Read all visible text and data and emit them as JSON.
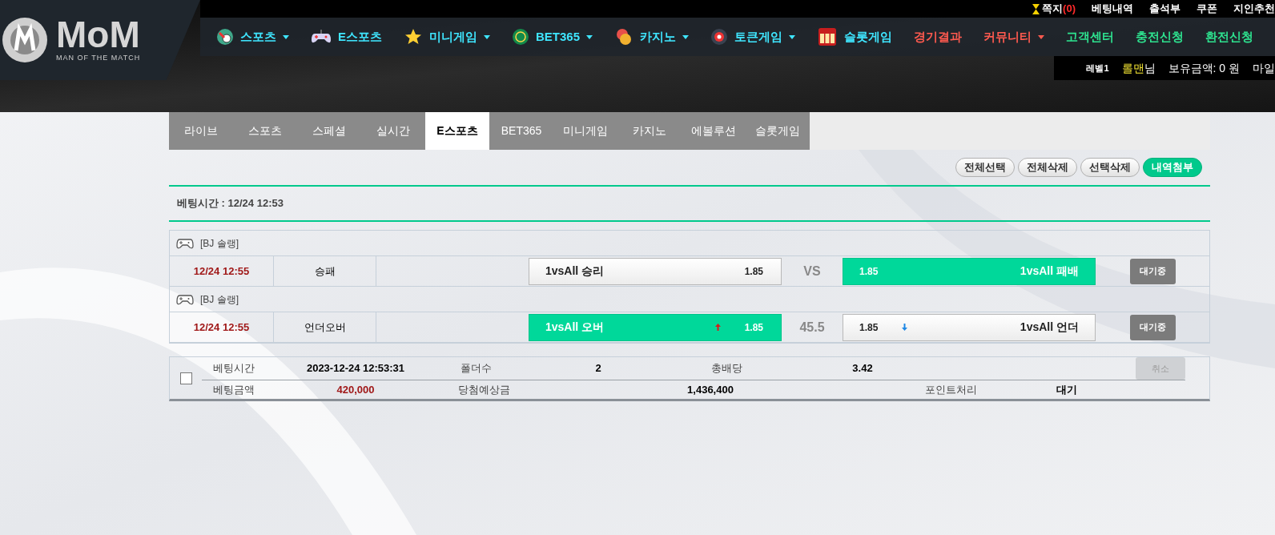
{
  "logo": {
    "title": "MoM",
    "subtitle": "MAN OF THE MATCH"
  },
  "top_links": [
    {
      "label": "쪽지",
      "count": "(0)"
    },
    {
      "label": "베팅내역"
    },
    {
      "label": "출석부"
    },
    {
      "label": "쿠폰"
    },
    {
      "label": "지인추천"
    }
  ],
  "nav": [
    {
      "label": "스포츠",
      "color": "#3fe6ff",
      "dropdown": true
    },
    {
      "label": "E스포츠",
      "color": "#3fe6ff",
      "dropdown": false
    },
    {
      "label": "미니게임",
      "color": "#3fe6ff",
      "dropdown": true
    },
    {
      "label": "BET365",
      "color": "#3fe6ff",
      "dropdown": true
    },
    {
      "label": "카지노",
      "color": "#3fe6ff",
      "dropdown": true
    },
    {
      "label": "토큰게임",
      "color": "#3fe6ff",
      "dropdown": true
    },
    {
      "label": "슬롯게임",
      "color": "#3fe6ff",
      "dropdown": false
    },
    {
      "label": "경기결과",
      "color": "#ff5a4f",
      "dropdown": false
    },
    {
      "label": "커뮤니티",
      "color": "#ff5a4f",
      "dropdown": true
    },
    {
      "label": "고객센터",
      "color": "#2ee28f",
      "dropdown": false
    },
    {
      "label": "충전신청",
      "color": "#2ee28f",
      "dropdown": false
    },
    {
      "label": "환전신청",
      "color": "#2ee28f",
      "dropdown": false
    }
  ],
  "user_bar": {
    "level": "레벨1",
    "name": "롤맨",
    "suffix": "님",
    "balance": "보유금액: 0 원",
    "mileage": "마일"
  },
  "tabs": [
    {
      "label": "라이브",
      "selected": false
    },
    {
      "label": "스포츠",
      "selected": false
    },
    {
      "label": "스페셜",
      "selected": false
    },
    {
      "label": "실시간",
      "selected": false
    },
    {
      "label": "E스포츠",
      "selected": true
    },
    {
      "label": "BET365",
      "selected": false
    },
    {
      "label": "미니게임",
      "selected": false
    },
    {
      "label": "카지노",
      "selected": false
    },
    {
      "label": "에볼루션",
      "selected": false
    },
    {
      "label": "슬롯게임",
      "selected": false
    }
  ],
  "action_buttons": [
    {
      "label": "전체선택",
      "kind": "normal"
    },
    {
      "label": "전체삭제",
      "kind": "normal"
    },
    {
      "label": "선택삭제",
      "kind": "normal"
    },
    {
      "label": "내역첨부",
      "kind": "primary"
    }
  ],
  "bet_time": "베팅시간 : 12/24 12:53",
  "games": [
    {
      "league": "[BJ 솔랭]",
      "time": "12/24 12:55",
      "market": "승패",
      "home": {
        "label": "1vsAll 승리",
        "odds": "1.85",
        "selected": false,
        "rising": false,
        "falling": false
      },
      "center": "VS",
      "away": {
        "label": "1vsAll 패배",
        "odds": "1.85",
        "selected": true,
        "rising": false,
        "falling": false
      },
      "status": "대기중"
    },
    {
      "league": "[BJ 솔랭]",
      "time": "12/24 12:55",
      "market": "언더오버",
      "home": {
        "label": "1vsAll 오버",
        "odds": "1.85",
        "selected": true,
        "rising": true,
        "falling": false
      },
      "center": "45.5",
      "away": {
        "label": "1vsAll 언더",
        "odds": "1.85",
        "selected": false,
        "rising": false,
        "falling": true
      },
      "status": "대기중"
    }
  ],
  "summary": {
    "checked": false,
    "row1": [
      {
        "label": "베팅시간",
        "value": "2023-12-24 12:53:31"
      },
      {
        "label": "폴더수",
        "value": "2"
      },
      {
        "label": "총배당",
        "value": "3.42"
      }
    ],
    "row2": [
      {
        "label": "베팅금액",
        "value": "420,000"
      },
      {
        "label": "당첨예상금",
        "value": "1,436,400"
      },
      {
        "label": "포인트처리",
        "value": "대기"
      }
    ],
    "cancel": {
      "label": "취소",
      "disabled": true
    }
  }
}
